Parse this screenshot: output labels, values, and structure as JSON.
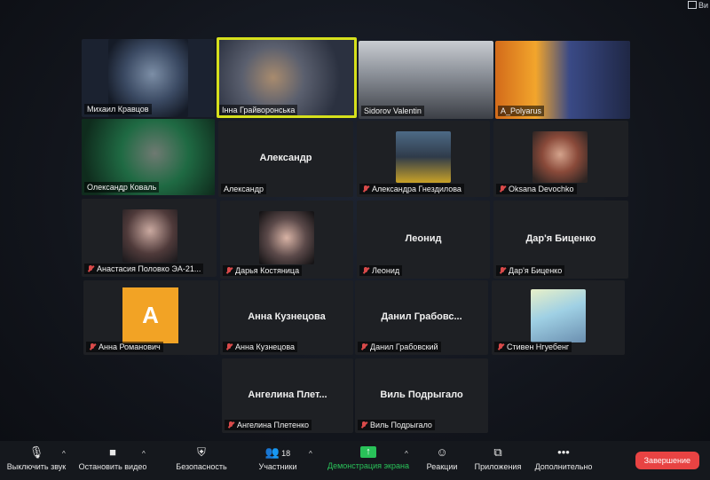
{
  "view_button": "Ви",
  "tiles": [
    {
      "name": "Михаил Кравцов"
    },
    {
      "name": "Інна Грайворонська"
    },
    {
      "name": "Sidorov Valentin"
    },
    {
      "name": "A_Polyarus"
    },
    {
      "name": "Олександр Коваль"
    },
    {
      "name": "Александр",
      "center": "Александр"
    },
    {
      "name": "Александра Гнездилова"
    },
    {
      "name": "Oksana Devochko"
    },
    {
      "name": "Анастасия Половко ЭА-21..."
    },
    {
      "name": "Дарья Костяница"
    },
    {
      "name": "Леонид",
      "center": "Леонид"
    },
    {
      "name": "Дар'я Биценко",
      "center": "Дар'я Биценко"
    },
    {
      "name": "Анна Романович",
      "avatar": "A"
    },
    {
      "name": "Анна Кузнецова",
      "center": "Анна Кузнецова"
    },
    {
      "name": "Данил Грабовский",
      "center": "Данил Грабовс..."
    },
    {
      "name": "Стивен Нгуебенг"
    },
    {
      "name": "Ангелина Плетенко",
      "center": "Ангелина Плет..."
    },
    {
      "name": "Виль Подрыгало",
      "center": "Виль Подрыгало"
    }
  ],
  "toolbar": {
    "mute": "Выключить звук",
    "video": "Остановить видео",
    "security": "Безопасность",
    "participants": "Участники",
    "participants_count": "18",
    "share": "Демонстрация экрана",
    "reactions": "Реакции",
    "apps": "Приложения",
    "more": "Дополнительно",
    "end": "Завершение"
  }
}
